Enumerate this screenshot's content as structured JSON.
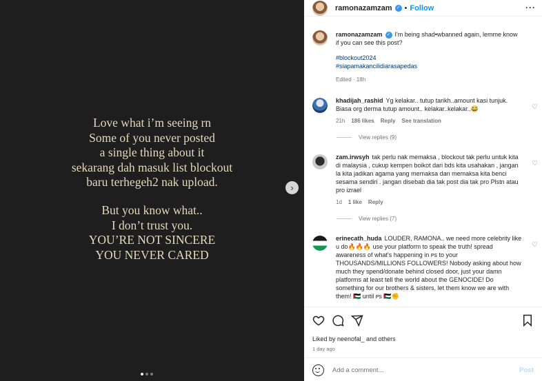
{
  "story": {
    "lines": [
      "Love what i’m seeing rn",
      "Some of you never posted",
      "a single thing about it",
      "sekarang dah masuk list blockout",
      "baru terhegeh2 nak upload.",
      "",
      "But you know what..",
      "I don’t trust you.",
      "YOU’RE NOT SINCERE",
      "YOU NEVER CARED"
    ],
    "next_icon": "›"
  },
  "header": {
    "username": "ramonazamzam",
    "verified_glyph": "✓",
    "separator": "•",
    "follow_label": "Follow",
    "more_label": "···"
  },
  "caption": {
    "username": "ramonazamzam",
    "text": "I'm being shad•wbanned again, lemme know if you can see this post?",
    "tags": [
      "#blockout2024",
      "#siapamakancilidiarasapedas"
    ],
    "edited": "Edited · 18h"
  },
  "comments": [
    {
      "username": "khadijah_rashid",
      "text": "Yg kelakar.. tutup tarikh..amount kasi tunjuk. Biasa org derma tutup amount.. kelakar..kelakar..😂",
      "time": "21h",
      "likes": "186 likes",
      "reply": "Reply",
      "extra": "See translation",
      "view_replies": "View replies (9)"
    },
    {
      "username": "zam.irwsyh",
      "text": "tak perlu nak memaksa , blockout tak perlu untuk kita di malaysia , cukup kempen boikot dari bds kita usahakan , jangan la kita jadikan agama yang memaksa dan memaksa kita benci sesama sendiri . jangan disebab dia tak post dia tak pro Plstn atau pro izrael",
      "time": "1d",
      "likes": "1 like",
      "reply": "Reply",
      "view_replies": "View replies (7)"
    },
    {
      "username": "erinecath_huda",
      "text": "LOUDER, RAMONA.. we need more celebrity like u do🔥🔥🔥 use your platform to speak the truth! spread awareness of what's happening in ᴘs to your THOUSANDS/MILLIONS FOLLOWERS! Nobody asking about how much they spend/donate behind closed door, just your damn platforms at least tell the world about the GENOCIDE! Do something for our brothers & sisters, let them know we are with them! 🇵🇸 until ᴘs 🇵🇸✊"
    }
  ],
  "footer": {
    "liked_by": "Liked by neenofal_ and others",
    "time_ago": "1 day ago",
    "comment_placeholder": "Add a comment...",
    "post_label": "Post"
  }
}
